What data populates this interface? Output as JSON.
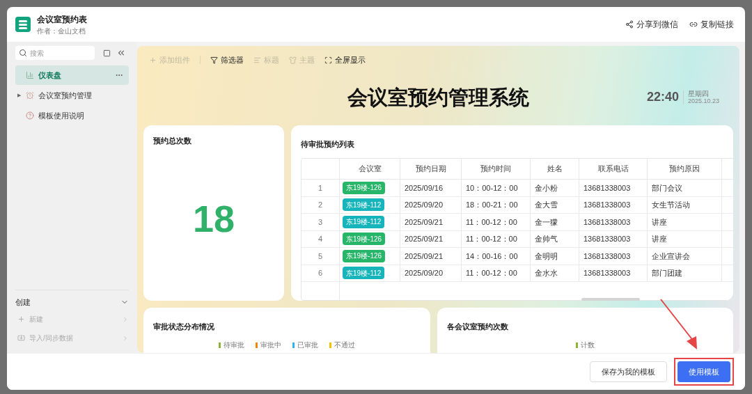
{
  "window": {
    "title": "会议室预约表",
    "author": "作者：金山文档",
    "actions": [
      {
        "kind": "share",
        "label": "分享到微信"
      },
      {
        "kind": "link",
        "label": "复制链接"
      }
    ]
  },
  "sidebar": {
    "search": {
      "placeholder": "搜索"
    },
    "items": [
      {
        "kind": "dashboard",
        "label": "仪表盘",
        "selected": true
      },
      {
        "kind": "table",
        "label": "会议室预约管理",
        "selected": false,
        "expander": "▶"
      },
      {
        "kind": "help",
        "label": "模板使用说明",
        "selected": false
      }
    ],
    "create": {
      "title": "创建",
      "expanded": true,
      "items": [
        {
          "kind": "new",
          "label": "新建",
          "disabled": true
        },
        {
          "kind": "import",
          "label": "导入/同步数据",
          "disabled": true
        }
      ]
    }
  },
  "toolbar": [
    {
      "kind": "add",
      "label": "添加组件",
      "disabled": true
    },
    {
      "kind": "filter",
      "label": "筛选器",
      "disabled": false
    },
    {
      "kind": "title",
      "label": "标题",
      "disabled": true
    },
    {
      "kind": "theme",
      "label": "主题",
      "disabled": true
    },
    {
      "kind": "fullscreen",
      "label": "全屏显示",
      "disabled": false
    }
  ],
  "dashboard": {
    "title": "会议室预约管理系统",
    "clock": {
      "time": "22:40",
      "weekday": "星期四",
      "date": "2025.10.23"
    },
    "total_card": {
      "title": "预约总次数",
      "value": "18"
    },
    "table_card": {
      "title": "待审批预约列表",
      "columns": [
        "会议室",
        "预约日期",
        "预约时间",
        "姓名",
        "联系电话",
        "预约原因"
      ],
      "rows": [
        {
          "index": "1",
          "room": {
            "label": "东19楼-126",
            "color": "#27b56a"
          },
          "date": "2025/09/16",
          "time": "10：00-12：00",
          "name": "金小粉",
          "phone": "13681338003",
          "reason": "部门会议"
        },
        {
          "index": "2",
          "room": {
            "label": "东19楼-112",
            "color": "#15b5bb"
          },
          "date": "2025/09/20",
          "time": "18：00-21：00",
          "name": "金大雪",
          "phone": "13681338003",
          "reason": "女生节活动"
        },
        {
          "index": "3",
          "room": {
            "label": "东19楼-112",
            "color": "#15b5bb"
          },
          "date": "2025/09/21",
          "time": "11：00-12：00",
          "name": "金一獴",
          "phone": "13681338003",
          "reason": "讲座"
        },
        {
          "index": "4",
          "room": {
            "label": "东19楼-126",
            "color": "#27b56a"
          },
          "date": "2025/09/21",
          "time": "11：00-12：00",
          "name": "金帅气",
          "phone": "13681338003",
          "reason": "讲座"
        },
        {
          "index": "5",
          "room": {
            "label": "东19楼-126",
            "color": "#27b56a"
          },
          "date": "2025/09/21",
          "time": "14：00-16：00",
          "name": "金明明",
          "phone": "13681338003",
          "reason": "企业宣讲会"
        },
        {
          "index": "6",
          "room": {
            "label": "东19楼-112",
            "color": "#15b5bb"
          },
          "date": "2025/09/20",
          "time": "11：00-12：00",
          "name": "金水水",
          "phone": "13681338003",
          "reason": "部门团建"
        }
      ]
    },
    "status_card": {
      "title": "审批状态分布情况",
      "legend": [
        {
          "label": "待审批",
          "color": "#8ab832"
        },
        {
          "label": "审批中",
          "color": "#f0870a"
        },
        {
          "label": "已审批",
          "color": "#2fb3ee"
        },
        {
          "label": "不通过",
          "color": "#f2c200"
        }
      ]
    },
    "rooms_card": {
      "title": "各会议室预约次数",
      "legend": [
        {
          "label": "计数",
          "color": "#8ab832"
        }
      ]
    }
  },
  "footer": {
    "buttons": [
      {
        "kind": "secondary",
        "label": "保存为我的模板"
      },
      {
        "kind": "primary",
        "label": "使用模板",
        "highlighted": true
      }
    ]
  }
}
